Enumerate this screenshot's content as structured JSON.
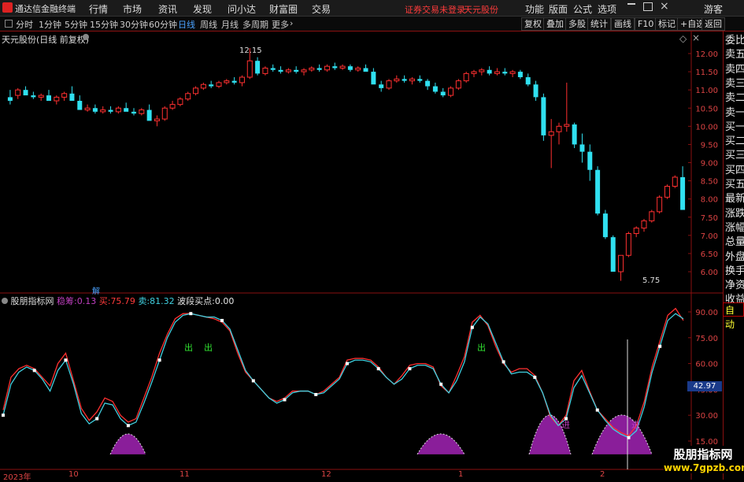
{
  "topbar": {
    "app_title": "通达信金融终端",
    "menus": [
      "行情",
      "市场",
      "资讯",
      "发现",
      "问小达",
      "财富圈",
      "交易"
    ],
    "warning": "证券交易未登录",
    "stock": "天元股份",
    "right_menus": [
      "功能",
      "版面",
      "公式",
      "选项"
    ],
    "guest": "游客"
  },
  "periodbar": {
    "periods": [
      "分时",
      "1分钟",
      "5分钟",
      "15分钟",
      "30分钟",
      "60分钟",
      "日线",
      "周线",
      "月线",
      "多周期",
      "更多"
    ],
    "active": "日线",
    "tools": [
      "复权",
      "叠加",
      "多股",
      "统计",
      "画线",
      "F10",
      "标记",
      "+自选",
      "返回"
    ]
  },
  "main": {
    "title": "天元股份(日线 前复权)",
    "high_label": "12.15",
    "low_label": "5.75",
    "jie_label": "解"
  },
  "indicator": {
    "name": "股朋指标网",
    "items": [
      {
        "label": "稳筹:",
        "value": "0.13",
        "color": "#c040c0"
      },
      {
        "label": "买:",
        "value": "75.79",
        "color": "#ff3b3b"
      },
      {
        "label": "卖:",
        "value": "81.32",
        "color": "#40d0e0"
      },
      {
        "label": "波段买点:",
        "value": "0.00",
        "color": "#e8e8e8"
      }
    ],
    "chu": "出",
    "jin": "进",
    "current_value": "42.97"
  },
  "price_axis": [
    "12.00",
    "11.50",
    "11.00",
    "10.50",
    "10.00",
    "9.50",
    "9.00",
    "8.50",
    "8.00",
    "7.50",
    "7.00",
    "6.50",
    "6.00"
  ],
  "ind_axis": [
    "90.00",
    "75.00",
    "60.00",
    "45.00",
    "30.00",
    "15.00"
  ],
  "right_panel": [
    "委比",
    "卖五",
    "卖四",
    "卖三",
    "卖二",
    "卖一",
    "买一",
    "买二",
    "买三",
    "买四",
    "买五",
    "最新",
    "涨跌",
    "涨幅",
    "总量",
    "外盘",
    "换手",
    "净资",
    "收益"
  ],
  "auto_label": "自动",
  "dates": [
    "2023年",
    "10",
    "11",
    "12",
    "1",
    "2"
  ],
  "watermark": {
    "title": "股朋指标网",
    "url": "www.7gpzb.com"
  },
  "colors": {
    "up": "#ff3030",
    "down": "#30e0f0",
    "axis": "#8a1010",
    "purple": "#8a1e9a"
  },
  "chart_data": {
    "type": "candlestick",
    "ylim": [
      5.75,
      12.15
    ],
    "candles": [
      [
        10.8,
        11.0,
        10.6,
        10.7
      ],
      [
        10.85,
        11.05,
        10.75,
        11.0
      ],
      [
        11.0,
        11.1,
        10.9,
        10.85
      ],
      [
        10.85,
        10.95,
        10.75,
        10.8
      ],
      [
        10.8,
        10.9,
        10.7,
        10.85
      ],
      [
        10.85,
        11.0,
        10.75,
        10.7
      ],
      [
        10.7,
        10.85,
        10.6,
        10.8
      ],
      [
        10.8,
        10.95,
        10.7,
        10.9
      ],
      [
        10.9,
        11.1,
        10.85,
        10.7
      ],
      [
        10.7,
        10.85,
        10.5,
        10.45
      ],
      [
        10.45,
        10.6,
        10.4,
        10.5
      ],
      [
        10.5,
        10.6,
        10.35,
        10.4
      ],
      [
        10.4,
        10.55,
        10.35,
        10.45
      ],
      [
        10.45,
        10.55,
        10.35,
        10.4
      ],
      [
        10.4,
        10.55,
        10.35,
        10.5
      ],
      [
        10.5,
        10.65,
        10.45,
        10.4
      ],
      [
        10.4,
        10.5,
        10.3,
        10.35
      ],
      [
        10.35,
        10.5,
        10.3,
        10.45
      ],
      [
        10.45,
        10.6,
        10.3,
        10.15
      ],
      [
        10.15,
        10.3,
        10.0,
        10.2
      ],
      [
        10.2,
        10.55,
        10.15,
        10.5
      ],
      [
        10.5,
        10.7,
        10.45,
        10.6
      ],
      [
        10.6,
        10.8,
        10.55,
        10.75
      ],
      [
        10.75,
        10.95,
        10.7,
        10.9
      ],
      [
        10.9,
        11.1,
        10.85,
        11.05
      ],
      [
        11.05,
        11.2,
        11.0,
        11.15
      ],
      [
        11.15,
        11.25,
        11.05,
        11.1
      ],
      [
        11.1,
        11.25,
        11.05,
        11.2
      ],
      [
        11.2,
        11.3,
        11.15,
        11.25
      ],
      [
        11.25,
        11.35,
        11.15,
        11.2
      ],
      [
        11.2,
        11.4,
        11.1,
        11.35
      ],
      [
        11.35,
        12.15,
        11.3,
        11.8
      ],
      [
        11.8,
        11.9,
        11.4,
        11.45
      ],
      [
        11.45,
        11.65,
        11.4,
        11.6
      ],
      [
        11.6,
        11.7,
        11.5,
        11.55
      ],
      [
        11.55,
        11.65,
        11.45,
        11.5
      ],
      [
        11.5,
        11.6,
        11.45,
        11.55
      ],
      [
        11.55,
        11.65,
        11.45,
        11.5
      ],
      [
        11.5,
        11.6,
        11.4,
        11.55
      ],
      [
        11.55,
        11.65,
        11.5,
        11.6
      ],
      [
        11.6,
        11.7,
        11.5,
        11.55
      ],
      [
        11.55,
        11.7,
        11.5,
        11.65
      ],
      [
        11.65,
        11.75,
        11.55,
        11.6
      ],
      [
        11.6,
        11.7,
        11.55,
        11.65
      ],
      [
        11.65,
        11.7,
        11.5,
        11.55
      ],
      [
        11.55,
        11.65,
        11.5,
        11.6
      ],
      [
        11.6,
        11.7,
        11.55,
        11.5
      ],
      [
        11.5,
        11.6,
        11.2,
        11.15
      ],
      [
        11.15,
        11.25,
        10.95,
        11.05
      ],
      [
        11.05,
        11.3,
        11.0,
        11.25
      ],
      [
        11.25,
        11.4,
        11.2,
        11.3
      ],
      [
        11.3,
        11.4,
        11.2,
        11.25
      ],
      [
        11.25,
        11.35,
        11.15,
        11.3
      ],
      [
        11.3,
        11.4,
        11.2,
        11.25
      ],
      [
        11.25,
        11.3,
        11.0,
        11.1
      ],
      [
        11.1,
        11.2,
        10.9,
        10.95
      ],
      [
        10.95,
        11.05,
        10.8,
        10.85
      ],
      [
        10.85,
        11.1,
        10.8,
        11.05
      ],
      [
        11.05,
        11.3,
        11.0,
        11.25
      ],
      [
        11.25,
        11.5,
        11.2,
        11.45
      ],
      [
        11.45,
        11.55,
        11.35,
        11.5
      ],
      [
        11.5,
        11.6,
        11.4,
        11.55
      ],
      [
        11.55,
        11.65,
        11.4,
        11.45
      ],
      [
        11.45,
        11.6,
        11.4,
        11.5
      ],
      [
        11.5,
        11.6,
        11.4,
        11.45
      ],
      [
        11.45,
        11.55,
        11.35,
        11.5
      ],
      [
        11.5,
        11.55,
        11.3,
        11.35
      ],
      [
        11.35,
        11.45,
        11.1,
        11.15
      ],
      [
        11.15,
        11.25,
        10.7,
        10.8
      ],
      [
        10.8,
        10.9,
        9.6,
        9.75
      ],
      [
        9.75,
        10.2,
        8.85,
        9.85
      ],
      [
        9.85,
        10.1,
        9.5,
        10.0
      ],
      [
        10.0,
        11.2,
        9.85,
        10.05
      ],
      [
        10.05,
        10.1,
        9.4,
        9.5
      ],
      [
        9.5,
        9.8,
        9.0,
        9.3
      ],
      [
        9.3,
        9.5,
        8.5,
        8.8
      ],
      [
        8.8,
        8.9,
        7.55,
        7.6
      ],
      [
        7.6,
        7.7,
        6.9,
        6.95
      ],
      [
        6.95,
        7.0,
        6.55,
        6.0
      ],
      [
        6.0,
        6.4,
        5.75,
        6.45
      ],
      [
        6.45,
        7.1,
        6.4,
        7.05
      ],
      [
        7.05,
        7.25,
        6.95,
        7.2
      ],
      [
        7.2,
        7.45,
        7.1,
        7.4
      ],
      [
        7.4,
        7.7,
        7.35,
        7.65
      ],
      [
        7.65,
        8.1,
        7.6,
        8.05
      ],
      [
        8.05,
        8.4,
        8.0,
        8.35
      ],
      [
        8.35,
        8.65,
        8.3,
        8.6
      ],
      [
        8.6,
        8.9,
        8.15,
        7.7
      ]
    ],
    "indicator_series": [
      {
        "name": "买",
        "values": [
          33,
          52,
          57,
          59,
          57,
          52,
          47,
          60,
          66,
          50,
          34,
          27,
          32,
          40,
          38,
          30,
          26,
          28,
          40,
          52,
          66,
          77,
          86,
          89,
          89,
          88,
          87,
          86,
          84,
          79,
          66,
          55,
          50,
          45,
          40,
          38,
          40,
          44,
          44,
          44,
          42,
          44,
          48,
          52,
          62,
          63,
          63,
          62,
          58,
          52,
          48,
          53,
          59,
          60,
          60,
          58,
          47,
          43,
          53,
          64,
          84,
          88,
          82,
          70,
          60,
          55,
          57,
          57,
          53,
          43,
          29,
          24,
          30,
          50,
          56,
          44,
          33,
          28,
          23,
          20,
          18,
          24,
          38,
          58,
          73,
          88,
          92,
          85
        ]
      },
      {
        "name": "卖",
        "values": [
          30,
          48,
          55,
          58,
          56,
          51,
          44,
          56,
          62,
          48,
          31,
          25,
          28,
          37,
          36,
          28,
          24,
          26,
          37,
          49,
          62,
          75,
          84,
          88,
          89,
          88,
          87,
          87,
          85,
          80,
          68,
          56,
          50,
          45,
          40,
          37,
          39,
          43,
          44,
          44,
          42,
          43,
          47,
          51,
          60,
          62,
          62,
          61,
          57,
          52,
          48,
          51,
          57,
          59,
          59,
          57,
          48,
          43,
          50,
          61,
          81,
          87,
          83,
          72,
          61,
          54,
          55,
          55,
          52,
          43,
          30,
          24,
          28,
          46,
          53,
          43,
          33,
          27,
          22,
          19,
          17,
          21,
          35,
          55,
          70,
          85,
          89,
          86
        ]
      }
    ],
    "ind_ylim": [
      10,
      95
    ]
  }
}
